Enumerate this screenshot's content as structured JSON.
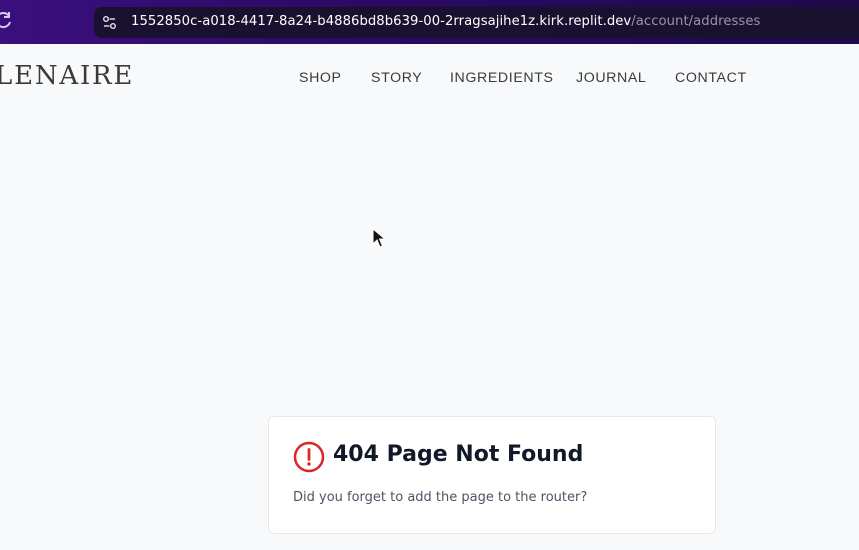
{
  "browser": {
    "url_host": "1552850c-a018-4417-8a24-b4886bd8b639-00-2rragsajihe1z.kirk.replit.dev",
    "url_path": "/account/addresses",
    "reload_icon": "reload-icon",
    "site_info_icon": "site-info-icon"
  },
  "header": {
    "logo": "LENAIRE",
    "nav": [
      {
        "label": "SHOP"
      },
      {
        "label": "STORY"
      },
      {
        "label": "INGREDIENTS"
      },
      {
        "label": "JOURNAL"
      },
      {
        "label": "CONTACT"
      }
    ]
  },
  "error": {
    "icon": "alert-circle-icon",
    "title": "404 Page Not Found",
    "message": "Did you forget to add the page to the router?",
    "accent_color": "#dc2626"
  },
  "colors": {
    "browser_bar": "#2a0a62",
    "page_background": "#f8f9fb",
    "text": "#3a3a3a"
  }
}
